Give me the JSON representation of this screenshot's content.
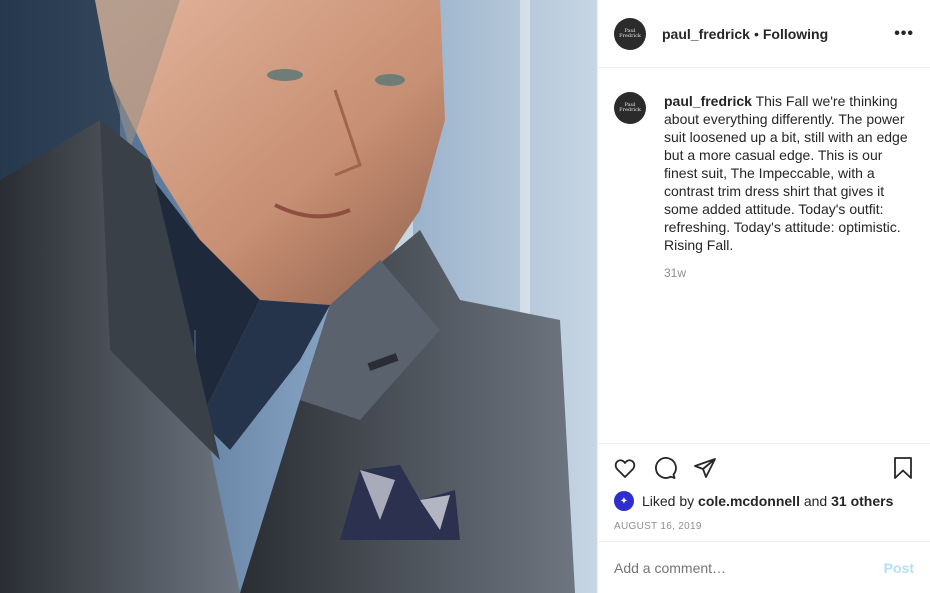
{
  "post": {
    "username": "paul_fredrick",
    "separator": "•",
    "follow_status": "Following",
    "more_label": "•••",
    "avatar_text": "Paul Fredrick",
    "caption": "This Fall we're thinking about everything differently. The power suit loosened up a bit, still with an edge but a more casual edge. This is our finest suit, The Impeccable, with a contrast trim dress shirt that gives it some added attitude. Today's outfit: refreshing. Today's attitude: optimistic. Rising Fall.",
    "age": "31w",
    "likes_prefix": "Liked by",
    "liked_by": "cole.mcdonnell",
    "likes_and": "and",
    "likes_others": "31 others",
    "date": "AUGUST 16, 2019",
    "comment_placeholder": "Add a comment…",
    "post_button": "Post"
  },
  "icons": {
    "like": "heart-icon",
    "comment": "comment-icon",
    "share": "paper-plane-icon",
    "save": "bookmark-icon"
  },
  "colors": {
    "post_button": "#b2dffc",
    "muted": "#8e8e8e",
    "text": "#262626"
  }
}
